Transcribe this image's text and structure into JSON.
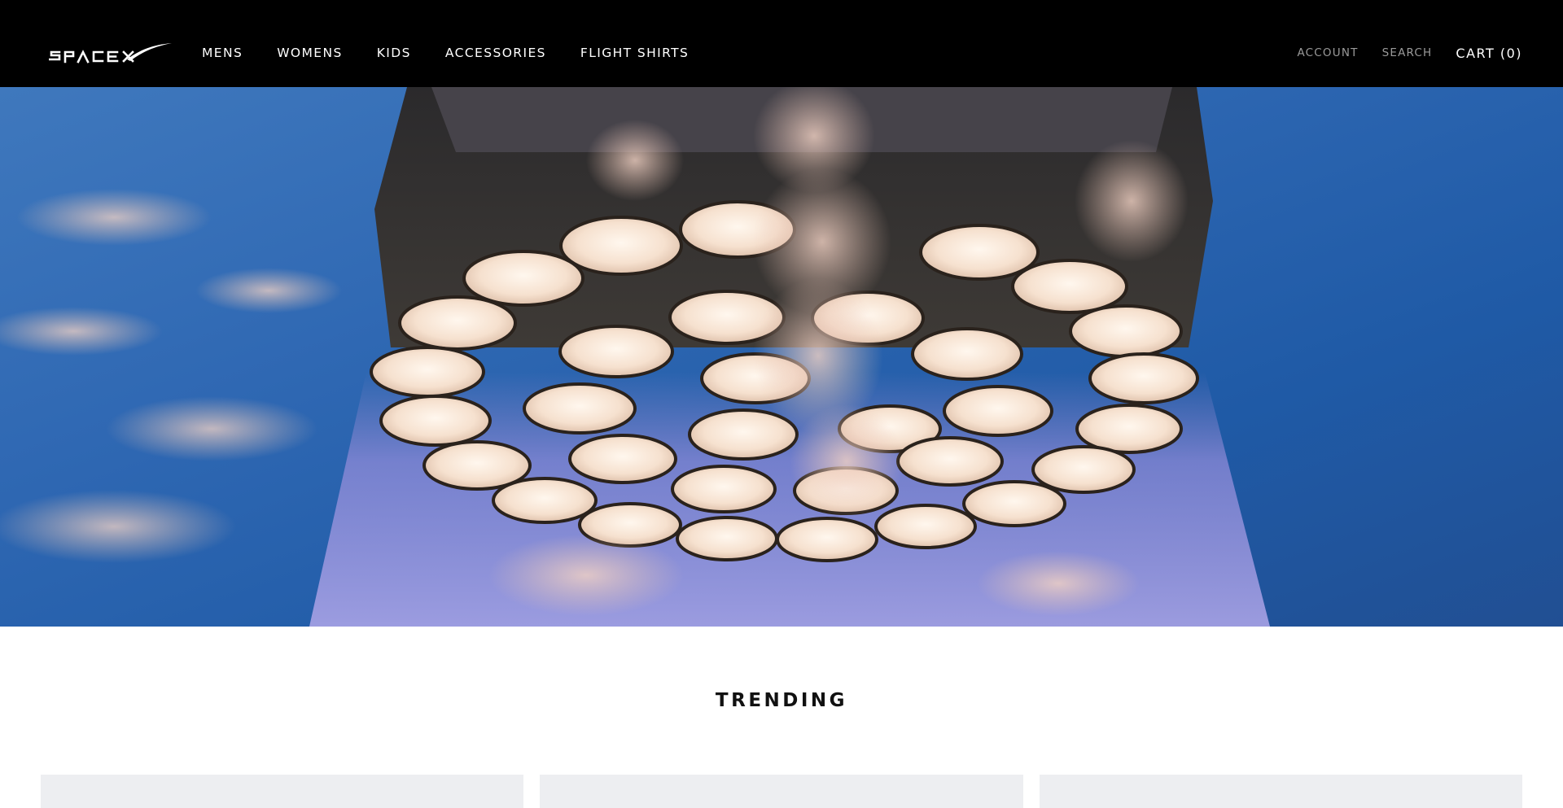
{
  "brand": {
    "name": "SPACEX",
    "logo_icon": "spacex-logo-icon"
  },
  "nav": {
    "items": [
      {
        "label": "MENS"
      },
      {
        "label": "WOMENS"
      },
      {
        "label": "KIDS"
      },
      {
        "label": "ACCESSORIES"
      },
      {
        "label": "FLIGHT SHIRTS"
      }
    ]
  },
  "utility": {
    "account_label": "ACCOUNT",
    "search_label": "SEARCH",
    "cart_label": "CART (0)"
  },
  "hero": {
    "image_icon": "rocket-engines-hero-image"
  },
  "trending": {
    "title": "TRENDING",
    "products": [
      {
        "icon": "product-image"
      },
      {
        "icon": "product-image"
      },
      {
        "icon": "product-image"
      }
    ]
  },
  "colors": {
    "header_bg": "#000000",
    "nav_text": "#ffffff",
    "utility_muted": "#9a9a9a",
    "sky": "#2f68b3",
    "card_placeholder": "#edeef1"
  }
}
